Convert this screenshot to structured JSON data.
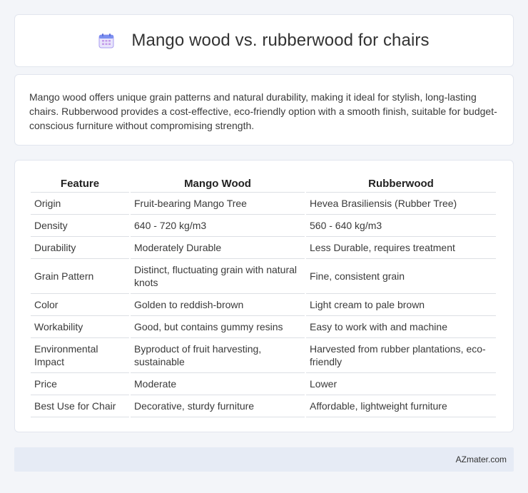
{
  "header": {
    "title": "Mango wood vs. rubberwood for chairs",
    "icon": "calendar-icon"
  },
  "summary": {
    "text": "Mango wood offers unique grain patterns and natural durability, making it ideal for stylish, long-lasting chairs. Rubberwood provides a cost-effective, eco-friendly option with a smooth finish, suitable for budget-conscious furniture without compromising strength."
  },
  "table": {
    "headers": [
      "Feature",
      "Mango Wood",
      "Rubberwood"
    ],
    "rows": [
      [
        "Origin",
        "Fruit-bearing Mango Tree",
        "Hevea Brasiliensis (Rubber Tree)"
      ],
      [
        "Density",
        "640 - 720 kg/m3",
        "560 - 640 kg/m3"
      ],
      [
        "Durability",
        "Moderately Durable",
        "Less Durable, requires treatment"
      ],
      [
        "Grain Pattern",
        "Distinct, fluctuating grain with natural knots",
        "Fine, consistent grain"
      ],
      [
        "Color",
        "Golden to reddish-brown",
        "Light cream to pale brown"
      ],
      [
        "Workability",
        "Good, but contains gummy resins",
        "Easy to work with and machine"
      ],
      [
        "Environmental Impact",
        "Byproduct of fruit harvesting, sustainable",
        "Harvested from rubber plantations, eco-friendly"
      ],
      [
        "Price",
        "Moderate",
        "Lower"
      ],
      [
        "Best Use for Chair",
        "Decorative, sturdy furniture",
        "Affordable, lightweight furniture"
      ]
    ]
  },
  "footer": {
    "brand": "AZmater.com"
  },
  "colors": {
    "page_bg": "#f3f5f9",
    "card_bg": "#ffffff",
    "footer_bg": "#e6ebf5",
    "icon_accent": "#7b8ff0"
  }
}
